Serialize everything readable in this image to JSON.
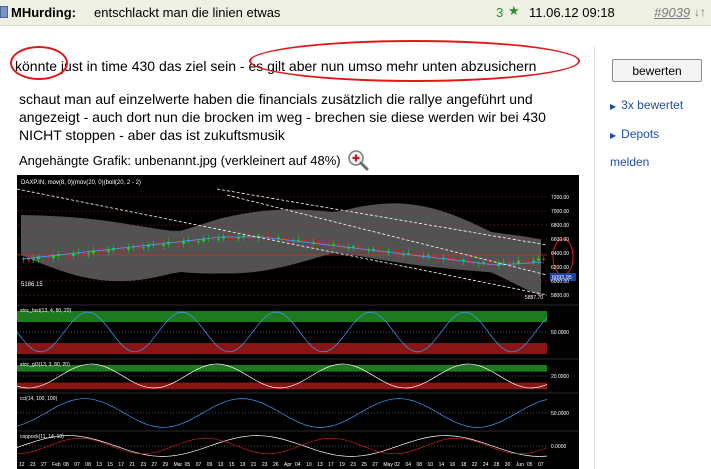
{
  "header": {
    "author": "MHurding:",
    "subject": "entschlackt man die linien etwas",
    "rating": "3",
    "datetime": "11.06.12 09:18",
    "post_number": "#9039",
    "arrows": "↓↑"
  },
  "post": {
    "line1_before": "könnte just in time 430 das ziel sein",
    "line1_after": "- es gilt aber nun umso mehr unten abzusichern",
    "paragraph": "schaut man auf einzelwerte haben die financials zusätzlich die rallye angeführt und angezeigt - auch dort nun die brocken im weg - brechen sie diese werden wir bei 430 NICHT stoppen - aber das ist zukuftsmusik",
    "attachment_label": "Angehängte Grafik: unbenannt.jpg (verkleinert auf 48%)"
  },
  "sidebar": {
    "rate_button": "bewerten",
    "rated_link": "3x bewertet",
    "depots_link": "Depots",
    "report_link": "melden"
  },
  "chart": {
    "title": "DAXP.IN, mov(8, 0)(mov(20, 0)(boll(20, 2 - 2)",
    "price_levels": [
      "7200.00",
      "7000.00",
      "6800.00",
      "6600.00",
      "6400.00",
      "6200.00",
      "6000.00",
      "5800.00"
    ],
    "price_tag": "6093.95",
    "left_label": "5186.15",
    "low_label": "5887.70",
    "sub_titles": [
      "stoc_fast(13, 4, 80, 20)",
      "stoc_gl3(13, 3, 80, 20)",
      "cci(14, 100, 100)",
      "coppock(11, 14, 10)"
    ],
    "sub_levels": [
      "50.0000",
      "20.0000",
      "50.0000",
      "0.0000"
    ],
    "x_labels": [
      "12",
      "23",
      "27",
      "Feb",
      "08",
      "07",
      "08",
      "13",
      "15",
      "17",
      "21",
      "23",
      "27",
      "29",
      "Mar",
      "05",
      "07",
      "09",
      "13",
      "15",
      "19",
      "21",
      "23",
      "26",
      "Apr",
      "04",
      "10",
      "13",
      "17",
      "19",
      "23",
      "25",
      "27",
      "May",
      "02",
      "04",
      "08",
      "10",
      "14",
      "16",
      "18",
      "22",
      "24",
      "28",
      "30",
      "Jun",
      "05",
      "07"
    ]
  },
  "colors": {
    "header_bg": "#eef0e3",
    "rating": "#2e8b2e",
    "link": "#1f4fa3",
    "annotation": "#e01818"
  }
}
